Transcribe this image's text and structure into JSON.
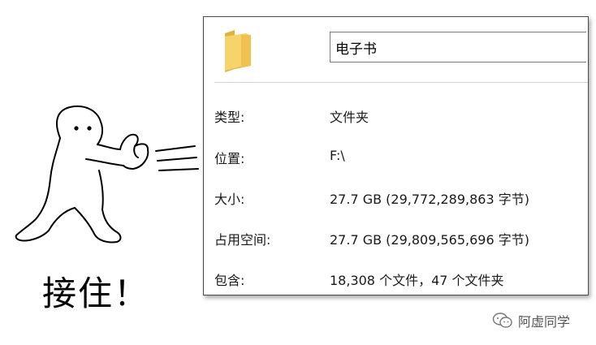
{
  "cartoon": {
    "caption": "接住！"
  },
  "properties": {
    "folder_name": "电子书",
    "rows": [
      {
        "label": "类型:",
        "value": "文件夹"
      },
      {
        "label": "位置:",
        "value": "F:\\"
      },
      {
        "label": "大小:",
        "value": "27.7 GB (29,772,289,863 字节)"
      },
      {
        "label": "占用空间:",
        "value": "27.7 GB (29,809,565,696 字节)"
      },
      {
        "label": "包含:",
        "value": "18,308 个文件，47 个文件夹"
      }
    ],
    "icon": "folder-icon"
  },
  "watermark": {
    "icon": "wechat-icon",
    "text": "阿虚同学"
  },
  "colors": {
    "folder_yellow": "#f2c94c",
    "folder_dark": "#dba930"
  }
}
